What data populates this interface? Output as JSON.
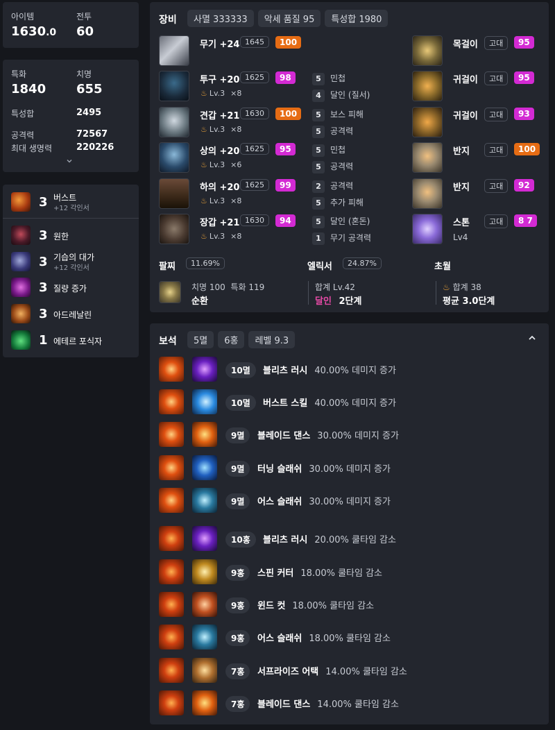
{
  "summary": {
    "item_label": "아이템",
    "item_value": "1630.0",
    "battle_label": "전투",
    "battle_value": "60"
  },
  "stats": {
    "spec_label": "특화",
    "spec_value": "1840",
    "crit_label": "치명",
    "crit_value": "655",
    "trait_label": "특성합",
    "trait_value": "2495",
    "atk_label": "공격력",
    "atk_value": "72567",
    "hp_label": "최대 생명력",
    "hp_value": "220226"
  },
  "engravings": [
    {
      "level": "3",
      "name": "버스트",
      "sub": "+12 각인서"
    },
    {
      "level": "3",
      "name": "원한",
      "sub": ""
    },
    {
      "level": "3",
      "name": "기습의 대가",
      "sub": "+12 각인서"
    },
    {
      "level": "3",
      "name": "질량 증가",
      "sub": ""
    },
    {
      "level": "3",
      "name": "아드레날린",
      "sub": ""
    },
    {
      "level": "1",
      "name": "에테르 포식자",
      "sub": ""
    }
  ],
  "equipment": {
    "title": "장비",
    "tags": [
      "사멸 333333",
      "악세 품질 95",
      "특성합 1980"
    ],
    "left": [
      {
        "name": "무기 +24",
        "ilvl": "1645",
        "quality": "100",
        "qcolor": "orange",
        "sub": "",
        "count": ""
      },
      {
        "name": "투구 +20",
        "ilvl": "1625",
        "quality": "98",
        "qcolor": "pink",
        "sub": "Lv.3",
        "count": "×8"
      },
      {
        "name": "견갑 +21",
        "ilvl": "1630",
        "quality": "100",
        "qcolor": "orange",
        "sub": "Lv.3",
        "count": "×8"
      },
      {
        "name": "상의 +20",
        "ilvl": "1625",
        "quality": "95",
        "qcolor": "pink",
        "sub": "Lv.3",
        "count": "×6"
      },
      {
        "name": "하의 +20",
        "ilvl": "1625",
        "quality": "99",
        "qcolor": "pink",
        "sub": "Lv.3",
        "count": "×8"
      },
      {
        "name": "장갑 +21",
        "ilvl": "1630",
        "quality": "94",
        "qcolor": "pink",
        "sub": "Lv.3",
        "count": "×8"
      }
    ],
    "elixirs": [
      {
        "n": "5",
        "t": "민첩"
      },
      {
        "n": "4",
        "t": "달인 (질서)"
      },
      {
        "n": "5",
        "t": "보스 피해"
      },
      {
        "n": "5",
        "t": "공격력"
      },
      {
        "n": "5",
        "t": "민첩"
      },
      {
        "n": "5",
        "t": "공격력"
      },
      {
        "n": "2",
        "t": "공격력"
      },
      {
        "n": "5",
        "t": "추가 피해"
      },
      {
        "n": "5",
        "t": "달인 (혼돈)"
      },
      {
        "n": "1",
        "t": "무기 공격력"
      }
    ],
    "right": [
      {
        "name": "목걸이",
        "grade": "고대",
        "quality": "95",
        "qcolor": "pink"
      },
      {
        "name": "귀걸이",
        "grade": "고대",
        "quality": "95",
        "qcolor": "pink"
      },
      {
        "name": "귀걸이",
        "grade": "고대",
        "quality": "93",
        "qcolor": "pink"
      },
      {
        "name": "반지",
        "grade": "고대",
        "quality": "100",
        "qcolor": "orange"
      },
      {
        "name": "반지",
        "grade": "고대",
        "quality": "92",
        "qcolor": "pink"
      },
      {
        "name": "스톤",
        "grade": "고대",
        "quality": "8 7",
        "qcolor": "pink",
        "sub": "Lv4"
      }
    ],
    "bracelet": {
      "title": "팔찌",
      "pct": "11.69%",
      "stats": "치명 100  특화 119",
      "name": "순환"
    },
    "elixir_sum": {
      "title": "엘릭서",
      "pct": "24.87%",
      "total": "합계 Lv.42",
      "kind": "달인",
      "stage": "2단계"
    },
    "transcend": {
      "title": "초월",
      "total": "합계 38",
      "avg": "평균 3.0단계"
    }
  },
  "gems": {
    "title": "보석",
    "tags": [
      "5멸",
      "6홍",
      "레벨 9.3"
    ],
    "items": [
      {
        "lvl": "10멸",
        "skill": "블리츠 러시",
        "effect": "40.00% 데미지 증가",
        "gem": "fire",
        "sk": "purple"
      },
      {
        "lvl": "10멸",
        "skill": "버스트 스킬",
        "effect": "40.00% 데미지 증가",
        "gem": "fire",
        "sk": "blue"
      },
      {
        "lvl": "9멸",
        "skill": "블레이드 댄스",
        "effect": "30.00% 데미지 증가",
        "gem": "fire",
        "sk": "orange"
      },
      {
        "lvl": "9멸",
        "skill": "터닝 슬래쉬",
        "effect": "30.00% 데미지 증가",
        "gem": "fire",
        "sk": "blue2"
      },
      {
        "lvl": "9멸",
        "skill": "어스 슬래쉬",
        "effect": "30.00% 데미지 증가",
        "gem": "fire",
        "sk": "teal"
      },
      {
        "lvl": "10홍",
        "skill": "블리츠 러시",
        "effect": "20.00% 쿨타임 감소",
        "gem": "ruby",
        "sk": "purple"
      },
      {
        "lvl": "9홍",
        "skill": "스핀 커터",
        "effect": "18.00% 쿨타임 감소",
        "gem": "ruby",
        "sk": "gold"
      },
      {
        "lvl": "9홍",
        "skill": "윈드 컷",
        "effect": "18.00% 쿨타임 감소",
        "gem": "ruby",
        "sk": "orange2"
      },
      {
        "lvl": "9홍",
        "skill": "어스 슬래쉬",
        "effect": "18.00% 쿨타임 감소",
        "gem": "ruby",
        "sk": "teal"
      },
      {
        "lvl": "7홍",
        "skill": "서프라이즈 어택",
        "effect": "14.00% 쿨타임 감소",
        "gem": "ruby",
        "sk": "gold2"
      },
      {
        "lvl": "7홍",
        "skill": "블레이드 댄스",
        "effect": "14.00% 쿨타임 감소",
        "gem": "ruby",
        "sk": "orange"
      }
    ]
  },
  "colors": {
    "pink": "#d32ad3",
    "orange": "#e66c14",
    "panel": "#23262e",
    "bg": "#15171c"
  }
}
